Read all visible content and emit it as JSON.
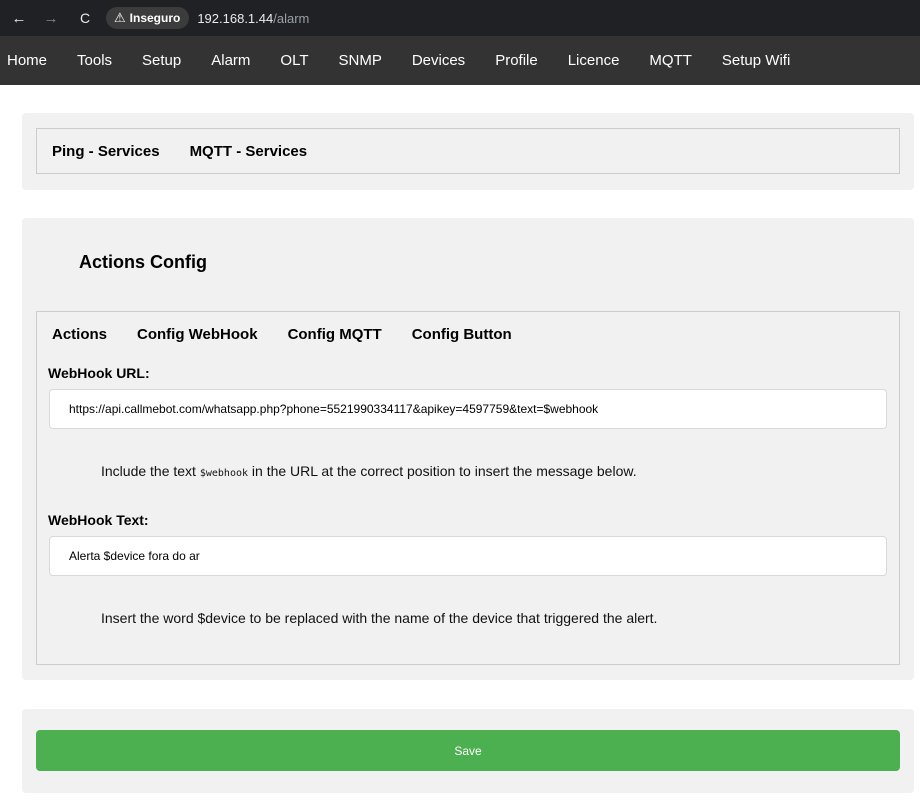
{
  "browser": {
    "back_icon": "←",
    "forward_icon": "→",
    "reload_icon": "C",
    "warning_icon": "⚠",
    "security_label": "Inseguro",
    "url_host": "192.168.1.44",
    "url_path": "/alarm"
  },
  "nav": {
    "items": [
      "Home",
      "Tools",
      "Setup",
      "Alarm",
      "OLT",
      "SNMP",
      "Devices",
      "Profile",
      "Licence",
      "MQTT",
      "Setup Wifi"
    ]
  },
  "services_tabs": [
    "Ping - Services",
    "MQTT - Services"
  ],
  "actions_config": {
    "title": "Actions Config",
    "tabs": [
      "Actions",
      "Config WebHook",
      "Config MQTT",
      "Config Button"
    ],
    "webhook_url_label": "WebHook URL:",
    "webhook_url_value": "https://api.callmebot.com/whatsapp.php?phone=5521990334117&apikey=4597759&text=$webhook",
    "hint1_before": "Include the text ",
    "hint1_code": "$webhook",
    "hint1_after": " in the URL at the correct position to insert the message below.",
    "webhook_text_label": "WebHook Text:",
    "webhook_text_value": "Alerta $device fora do ar",
    "hint2": "Insert the word $device to be replaced with the name of the device that triggered the alert."
  },
  "save_label": "Save",
  "colors": {
    "nav_bg": "#333333",
    "panel_bg": "#f1f1f1",
    "save_bg": "#4caf50"
  }
}
